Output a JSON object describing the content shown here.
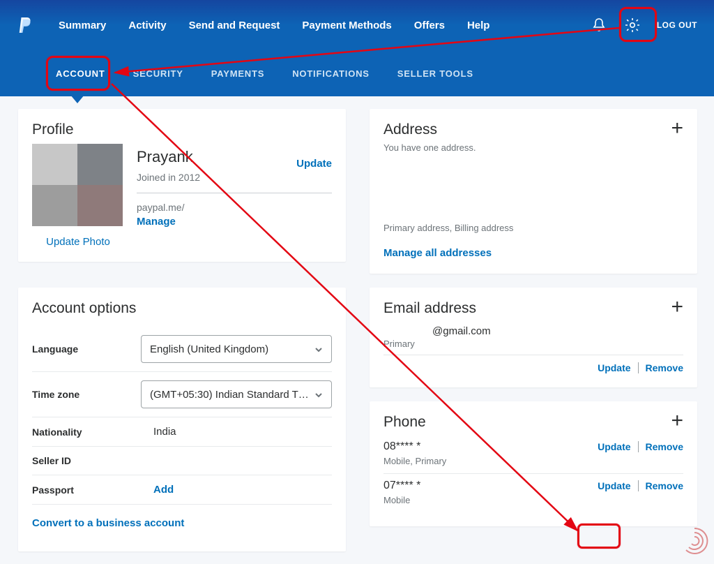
{
  "topnav": {
    "items": [
      "Summary",
      "Activity",
      "Send and Request",
      "Payment Methods",
      "Offers",
      "Help"
    ],
    "logout": "LOG OUT"
  },
  "subnav": {
    "items": [
      "ACCOUNT",
      "SECURITY",
      "PAYMENTS",
      "NOTIFICATIONS",
      "SELLER TOOLS"
    ],
    "active_index": 0
  },
  "profile": {
    "title": "Profile",
    "name": "Prayank",
    "joined": "Joined in 2012",
    "update": "Update",
    "update_photo": "Update Photo",
    "paypalme_label": "paypal.me/",
    "manage": "Manage"
  },
  "account_options": {
    "title": "Account options",
    "rows": {
      "language_label": "Language",
      "language_value": "English (United Kingdom)",
      "timezone_label": "Time zone",
      "timezone_value": "(GMT+05:30) Indian Standard T…",
      "nationality_label": "Nationality",
      "nationality_value": "India",
      "sellerid_label": "Seller ID",
      "sellerid_value": "",
      "passport_label": "Passport",
      "passport_action": "Add"
    },
    "convert": "Convert to a business account"
  },
  "address": {
    "title": "Address",
    "sub": "You have one address.",
    "primary": "Primary address, Billing address",
    "manage_all": "Manage all addresses"
  },
  "email": {
    "title": "Email address",
    "value": "@gmail.com",
    "type": "Primary",
    "update": "Update",
    "remove": "Remove"
  },
  "phone": {
    "title": "Phone",
    "update": "Update",
    "remove": "Remove",
    "items": [
      {
        "number": "08**** *",
        "type": "Mobile, Primary"
      },
      {
        "number": "07**** *",
        "type": "Mobile"
      }
    ]
  }
}
